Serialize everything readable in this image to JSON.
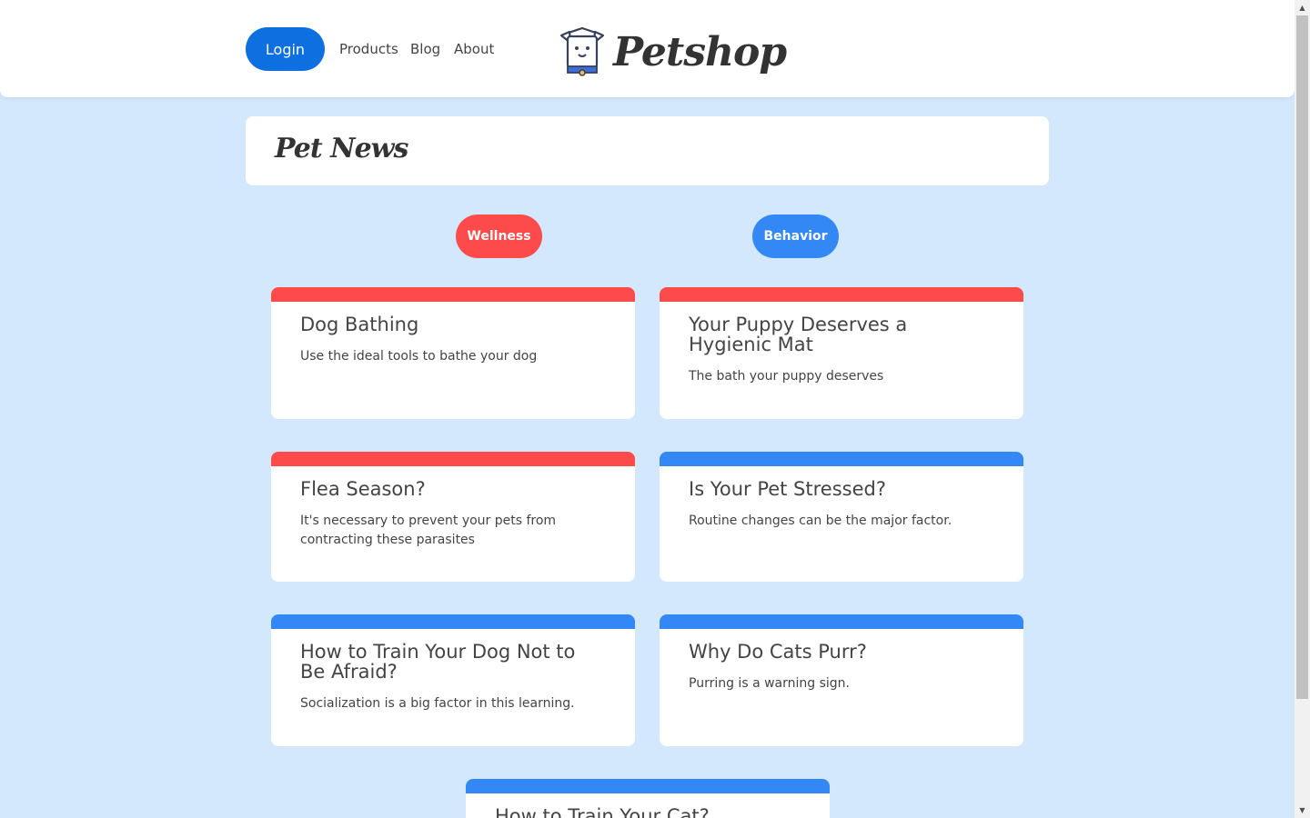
{
  "header": {
    "login_label": "Login",
    "nav": [
      "Products",
      "Blog",
      "About"
    ],
    "brand": "Petshop"
  },
  "main": {
    "title": "Pet News",
    "filters": [
      {
        "label": "Wellness",
        "color": "#fd4a4a"
      },
      {
        "label": "Behavior",
        "color": "#3388f5"
      }
    ],
    "cards": [
      {
        "title": "Dog Bathing",
        "description": "Use the ideal tools to bathe your dog",
        "category": "Wellness"
      },
      {
        "title": "Your Puppy Deserves a Hygienic Mat",
        "description": "The bath your puppy deserves",
        "category": "Wellness"
      },
      {
        "title": "Flea Season?",
        "description": "It's necessary to prevent your pets from contracting these parasites",
        "category": "Wellness"
      },
      {
        "title": "Is Your Pet Stressed?",
        "description": "Routine changes can be the major factor.",
        "category": "Behavior"
      },
      {
        "title": "How to Train Your Dog Not to Be Afraid?",
        "description": "Socialization is a big factor in this learning.",
        "category": "Behavior"
      },
      {
        "title": "Why Do Cats Purr?",
        "description": "Purring is a warning sign.",
        "category": "Behavior"
      },
      {
        "title": "How to Train Your Cat?",
        "description": "",
        "category": "Behavior"
      }
    ]
  },
  "colors": {
    "background": "#d3e7fd",
    "primary": "#0d6fe0",
    "wellness": "#fd4a4a",
    "behavior": "#3388f5"
  },
  "icons": [
    "dog-mascot-logo-icon",
    "scroll-up-arrow-icon",
    "scroll-down-arrow-icon"
  ]
}
